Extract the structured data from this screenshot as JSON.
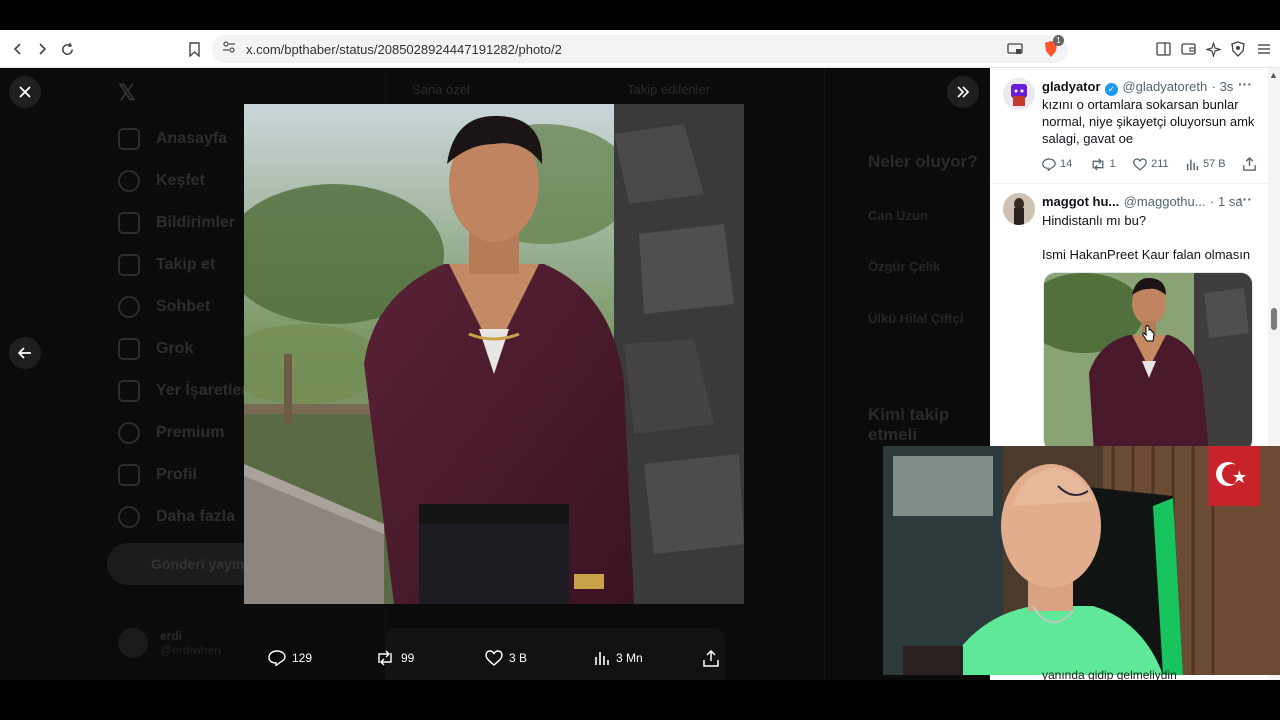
{
  "browser": {
    "url": "x.com/bpthaber/status/2085028924447191282/photo/2",
    "shield_badge": "1"
  },
  "background": {
    "tab_left": "Sana özel",
    "tab_right": "Takip edilenler",
    "sidebar_items": [
      "Anasayfa",
      "Keşfet",
      "Bildirimler",
      "Takip et",
      "Sohbet",
      "Grok",
      "Yer İşaretleri",
      "Premium",
      "Profil",
      "Daha fazla"
    ],
    "post_button": "Gönderi yayınla",
    "account_name": "erdi",
    "account_handle": "@erdiwhen",
    "whats_happening": "Neler oluyor?",
    "trends": [
      "Can Uzun",
      "Özgür Çelik",
      "Ülkü Hilal Çiftçi"
    ],
    "who_to_follow": "Kimi takip etmeli"
  },
  "photo_actions": {
    "replies": "129",
    "reposts": "99",
    "likes": "3 B",
    "views": "3 Mn"
  },
  "replies": [
    {
      "name": "gladyator",
      "handle": "@gladyatoreth",
      "time": "· 3s",
      "verified": true,
      "text": "kızını o ortamlara sokarsan bunlar normal, niye şikayetçi oluyorsun amk salagi, gavat oe",
      "stats": {
        "replies": "14",
        "reposts": "1",
        "likes": "211",
        "views": "57 B"
      }
    },
    {
      "name": "maggot hu...",
      "handle": "@maggothu...",
      "time": "· 1 sa",
      "verified": false,
      "text_line1": "Hindistanlı mı bu?",
      "text_line2": "Ismi HakanPreet Kaur falan olmasın"
    }
  ],
  "webcam_caption": "yanında gidip gelmeliydin",
  "colors": {
    "accent_blue": "#1d9bf0",
    "shirt": "#4a1a2c",
    "webcam_shirt": "#5fe89a"
  }
}
